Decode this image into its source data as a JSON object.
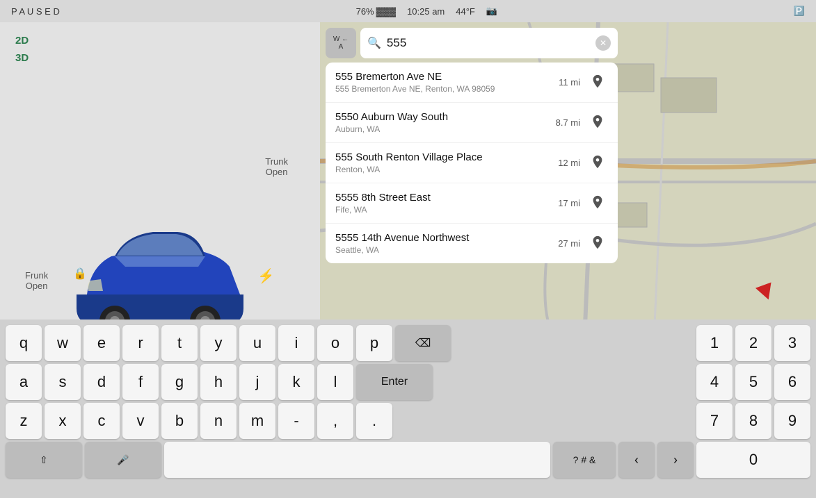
{
  "statusBar": {
    "left": "P  A  U  S  E  D",
    "battery": "76%",
    "time": "10:25 am",
    "temp": "44°F",
    "camera": "📷"
  },
  "viewButtons": {
    "btn2d": "2D",
    "btn3d": "3D"
  },
  "carLabels": {
    "frunk": "Frunk",
    "frunkStatus": "Open",
    "trunk": "Trunk",
    "trunkStatus": "Open"
  },
  "search": {
    "value": "555",
    "placeholder": "Search"
  },
  "navButton": {
    "line1": "W  ←",
    "line2": "A"
  },
  "results": [
    {
      "name": "555 Bremerton Ave NE",
      "address": "555 Bremerton Ave NE, Renton, WA 98059",
      "distance": "11 mi"
    },
    {
      "name": "5550 Auburn Way South",
      "address": "Auburn, WA",
      "distance": "8.7 mi"
    },
    {
      "name": "555 South Renton Village Place",
      "address": "Renton, WA",
      "distance": "12 mi"
    },
    {
      "name": "5555 8th Street East",
      "address": "Fife, WA",
      "distance": "17 mi"
    },
    {
      "name": "5555 14th Avenue Northwest",
      "address": "Seattle, WA",
      "distance": "27 mi"
    }
  ],
  "keyboard": {
    "row1": [
      "q",
      "w",
      "e",
      "r",
      "t",
      "y",
      "u",
      "i",
      "o",
      "p"
    ],
    "row2": [
      "a",
      "s",
      "d",
      "f",
      "g",
      "h",
      "j",
      "k",
      "l"
    ],
    "row3": [
      "z",
      "x",
      "c",
      "v",
      "b",
      "n",
      "m",
      "-",
      ",",
      "."
    ],
    "numpad": [
      [
        "1",
        "2",
        "3"
      ],
      [
        "4",
        "5",
        "6"
      ],
      [
        "7",
        "8",
        "9"
      ],
      [
        "0"
      ]
    ],
    "backspaceLabel": "⌫",
    "enterLabel": "Enter",
    "shiftLabel": "⇧",
    "micLabel": "🎤",
    "symbolLabel": "? # &",
    "leftLabel": "‹",
    "rightLabel": "›"
  },
  "colors": {
    "accent": "#2a7a4b",
    "keyBg": "#f5f5f5",
    "keySpecialBg": "#bcbcbc",
    "resultBg": "#ffffff",
    "mapBg": "#c8c8b8"
  }
}
